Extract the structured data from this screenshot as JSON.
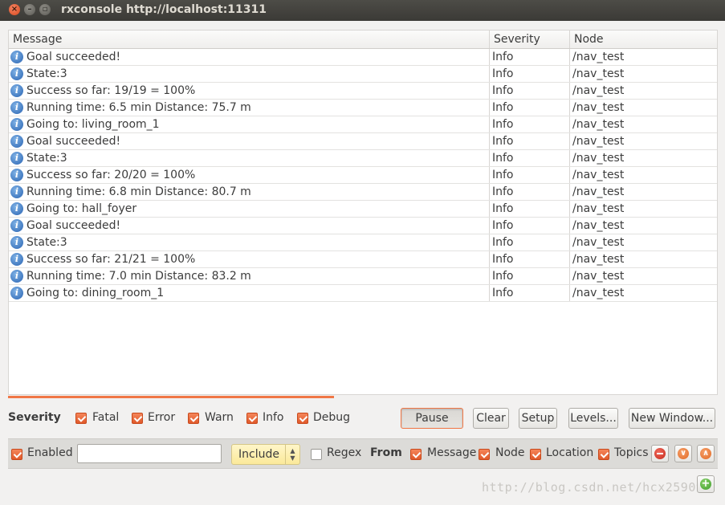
{
  "window": {
    "title": "rxconsole  http://localhost:11311"
  },
  "table": {
    "columns": [
      "Message",
      "Severity",
      "Node"
    ],
    "rows": [
      {
        "message": "Goal succeeded!",
        "severity": "Info",
        "node": "/nav_test"
      },
      {
        "message": "State:3",
        "severity": "Info",
        "node": "/nav_test"
      },
      {
        "message": "Success so far: 19/19 = 100%",
        "severity": "Info",
        "node": "/nav_test"
      },
      {
        "message": "Running time: 6.5 min Distance: 75.7 m",
        "severity": "Info",
        "node": "/nav_test"
      },
      {
        "message": "Going to: living_room_1",
        "severity": "Info",
        "node": "/nav_test"
      },
      {
        "message": "Goal succeeded!",
        "severity": "Info",
        "node": "/nav_test"
      },
      {
        "message": "State:3",
        "severity": "Info",
        "node": "/nav_test"
      },
      {
        "message": "Success so far: 20/20 = 100%",
        "severity": "Info",
        "node": "/nav_test"
      },
      {
        "message": "Running time: 6.8 min Distance: 80.7 m",
        "severity": "Info",
        "node": "/nav_test"
      },
      {
        "message": "Going to: hall_foyer",
        "severity": "Info",
        "node": "/nav_test"
      },
      {
        "message": "Goal succeeded!",
        "severity": "Info",
        "node": "/nav_test"
      },
      {
        "message": "State:3",
        "severity": "Info",
        "node": "/nav_test"
      },
      {
        "message": "Success so far: 21/21 = 100%",
        "severity": "Info",
        "node": "/nav_test"
      },
      {
        "message": "Running time: 7.0 min Distance: 83.2 m",
        "severity": "Info",
        "node": "/nav_test"
      },
      {
        "message": "Going to: dining_room_1",
        "severity": "Info",
        "node": "/nav_test"
      }
    ]
  },
  "severity": {
    "label": "Severity",
    "fatal": "Fatal",
    "error": "Error",
    "warn": "Warn",
    "info": "Info",
    "debug": "Debug"
  },
  "buttons": {
    "pause": "Pause",
    "clear": "Clear",
    "setup": "Setup",
    "levels": "Levels...",
    "new_window": "New Window..."
  },
  "filter": {
    "enabled": "Enabled",
    "text_value": "",
    "mode": "Include",
    "regex": "Regex",
    "from": "From",
    "message": "Message",
    "node": "Node",
    "location": "Location",
    "topics": "Topics"
  },
  "watermark": "http://blog.csdn.net/hcx25909",
  "colors": {
    "accent": "#f07746",
    "titlebar": "#3b3a36",
    "include_combo": "#fbe99a"
  }
}
